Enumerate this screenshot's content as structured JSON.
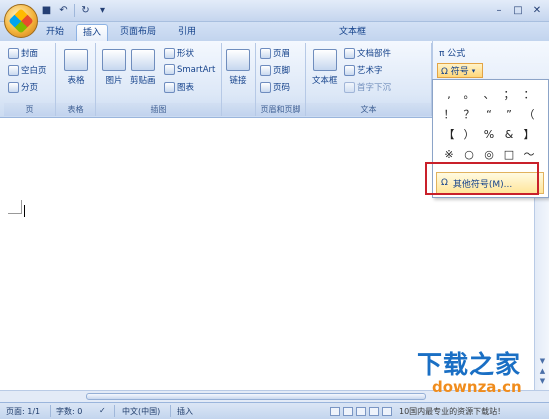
{
  "title_bar": {
    "qat_icons": [
      "save-icon",
      "undo-icon",
      "redo-icon",
      "dropdown-icon"
    ],
    "window_controls": [
      "minimize",
      "maximize",
      "close"
    ],
    "controls_glyphs": {
      "min": "–",
      "max": "□",
      "close": "✕"
    }
  },
  "tabs": {
    "start": "开始",
    "insert": "插入",
    "page_layout": "页面布局",
    "references": "引用",
    "text_tools": "文本框"
  },
  "ribbon": {
    "pages_group": {
      "label": "页",
      "cover": "封面",
      "blank_page": "空白页",
      "page_break": "分页"
    },
    "table_group": {
      "label": "表格",
      "table": "表格"
    },
    "illustrations_group": {
      "label": "插图",
      "picture": "图片",
      "clipart": "剪贴画",
      "shapes": "形状",
      "smartart": "SmartArt",
      "chart": "图表"
    },
    "links_group": {
      "label": "",
      "links": "链接"
    },
    "header_footer_group": {
      "label": "页眉和页脚",
      "header": "页眉",
      "footer": "页脚",
      "page_number": "页码"
    },
    "text_group": {
      "label": "文本",
      "textbox": "文本框",
      "quick_parts": "文档部件",
      "wordart": "艺术字",
      "dropcap": "首字下沉"
    },
    "symbols_group": {
      "formula": "π 公式",
      "symbol": "Ω 符号"
    }
  },
  "symbol_dropdown": {
    "symbols": [
      ",",
      "。",
      "、",
      "；",
      "：",
      "！",
      "？",
      "“",
      "”",
      "（",
      "【",
      "）",
      "%",
      "&",
      "】",
      "※",
      "○",
      "◎",
      "□",
      "～"
    ],
    "more_symbols": "其他符号(M)...",
    "more_icon": "Ω"
  },
  "status_bar": {
    "page": "页面: 1/1",
    "words": "字数: 0",
    "language": "中文(中国)",
    "mode": "插入",
    "promo": "10国内最专业的资源下载站！"
  },
  "watermark": {
    "text": "下载之家",
    "url": "downza.cn"
  },
  "colors": {
    "ribbon_bg": "#dde8f7",
    "highlight": "#c9202a",
    "watermark_blue": "#1a6fc4",
    "watermark_orange": "#f08c1c"
  }
}
